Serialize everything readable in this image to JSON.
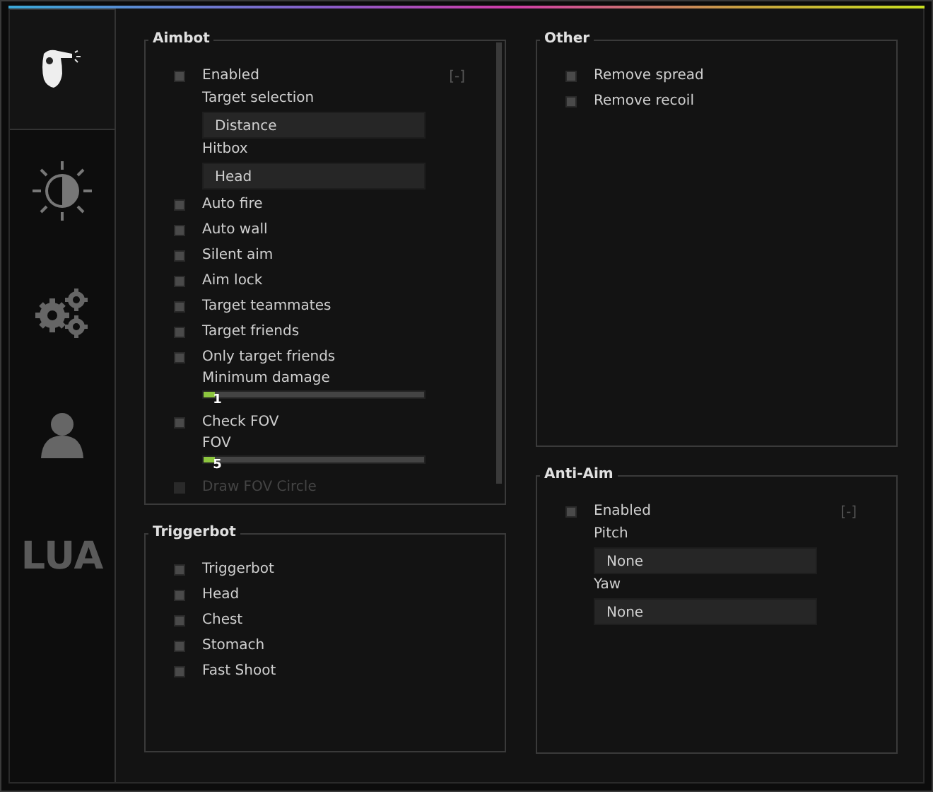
{
  "sidebar": {
    "tabs": [
      {
        "kind": "aim",
        "selected": true
      },
      {
        "kind": "visuals",
        "selected": false
      },
      {
        "kind": "settings",
        "selected": false
      },
      {
        "kind": "player",
        "selected": false
      },
      {
        "kind": "text",
        "label": "LUA",
        "selected": false
      }
    ]
  },
  "groups": [
    {
      "title": "Aimbot",
      "scrollable": true,
      "items": [
        {
          "kind": "checkbox",
          "label": "Enabled",
          "checked": false,
          "disabled": false,
          "toggle": "[-]"
        },
        {
          "kind": "combo",
          "label": "Target selection",
          "value": "Distance"
        },
        {
          "kind": "combo",
          "label": "Hitbox",
          "value": "Head"
        },
        {
          "kind": "checkbox",
          "label": "Auto fire",
          "checked": false,
          "disabled": false
        },
        {
          "kind": "checkbox",
          "label": "Auto wall",
          "checked": false,
          "disabled": false
        },
        {
          "kind": "checkbox",
          "label": "Silent aim",
          "checked": false,
          "disabled": false
        },
        {
          "kind": "checkbox",
          "label": "Aim lock",
          "checked": false,
          "disabled": false
        },
        {
          "kind": "checkbox",
          "label": "Target teammates",
          "checked": false,
          "disabled": false
        },
        {
          "kind": "checkbox",
          "label": "Target friends",
          "checked": false,
          "disabled": false
        },
        {
          "kind": "checkbox",
          "label": "Only target friends",
          "checked": false,
          "disabled": false
        },
        {
          "kind": "slider",
          "label": "Minimum damage",
          "level": 0.03,
          "reading": "1"
        },
        {
          "kind": "checkbox",
          "label": "Check FOV",
          "checked": false,
          "disabled": false
        },
        {
          "kind": "slider",
          "label": "FOV",
          "level": 0.03,
          "reading": "5"
        },
        {
          "kind": "checkbox",
          "label": "Draw FOV Circle",
          "checked": false,
          "disabled": true
        }
      ]
    },
    {
      "title": "Triggerbot",
      "scrollable": false,
      "items": [
        {
          "kind": "checkbox",
          "label": "Triggerbot",
          "checked": false,
          "disabled": false
        },
        {
          "kind": "checkbox",
          "label": "Head",
          "checked": false,
          "disabled": false
        },
        {
          "kind": "checkbox",
          "label": "Chest",
          "checked": false,
          "disabled": false
        },
        {
          "kind": "checkbox",
          "label": "Stomach",
          "checked": false,
          "disabled": false
        },
        {
          "kind": "checkbox",
          "label": "Fast Shoot",
          "checked": false,
          "disabled": false
        }
      ]
    },
    {
      "title": "Other",
      "scrollable": false,
      "items": [
        {
          "kind": "checkbox",
          "label": "Remove spread",
          "checked": false,
          "disabled": false
        },
        {
          "kind": "checkbox",
          "label": "Remove recoil",
          "checked": false,
          "disabled": false
        }
      ]
    },
    {
      "title": "Anti-Aim",
      "scrollable": false,
      "items": [
        {
          "kind": "checkbox",
          "label": "Enabled",
          "checked": false,
          "disabled": false,
          "toggle": "[-]"
        },
        {
          "kind": "combo",
          "label": "Pitch",
          "value": "None"
        },
        {
          "kind": "combo",
          "label": "Yaw",
          "value": "None"
        }
      ]
    }
  ]
}
